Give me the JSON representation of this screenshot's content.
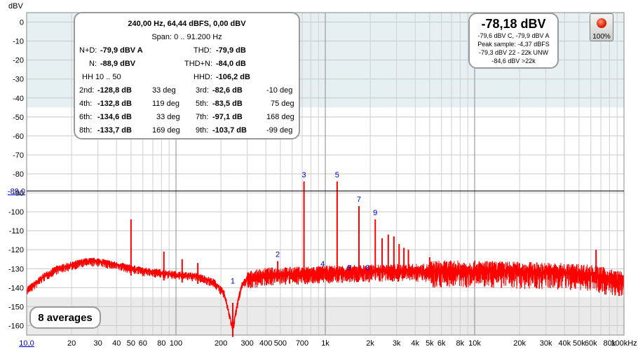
{
  "chart_data": {
    "type": "line",
    "title": "",
    "xlabel": "",
    "ylabel": "dBV",
    "x_unit": "kHz",
    "xscale": "log",
    "xlim": [
      10,
      100000
    ],
    "ylim": [
      -165,
      5
    ],
    "y_ticks": [
      "0",
      "-10",
      "-20",
      "-30",
      "-40",
      "-50",
      "-60",
      "-70",
      "-80",
      "-90",
      "-100",
      "-110",
      "-120",
      "-130",
      "-140",
      "-150",
      "-160"
    ],
    "x_tick_labels": [
      {
        "f": 20,
        "t": "20"
      },
      {
        "f": 30,
        "t": "30"
      },
      {
        "f": 40,
        "t": "40"
      },
      {
        "f": 50,
        "t": "50"
      },
      {
        "f": 60,
        "t": "60"
      },
      {
        "f": 80,
        "t": "80"
      },
      {
        "f": 100,
        "t": "100"
      },
      {
        "f": 200,
        "t": "200"
      },
      {
        "f": 300,
        "t": "300"
      },
      {
        "f": 400,
        "t": "400"
      },
      {
        "f": 500,
        "t": "500"
      },
      {
        "f": 700,
        "t": "700"
      },
      {
        "f": 1000,
        "t": "1k"
      },
      {
        "f": 2000,
        "t": "2k"
      },
      {
        "f": 3000,
        "t": "3k"
      },
      {
        "f": 4000,
        "t": "4k"
      },
      {
        "f": 5000,
        "t": "5k"
      },
      {
        "f": 6000,
        "t": "6k"
      },
      {
        "f": 8000,
        "t": "8k"
      },
      {
        "f": 10000,
        "t": "10k"
      },
      {
        "f": 20000,
        "t": "20k"
      },
      {
        "f": 30000,
        "t": "30k"
      },
      {
        "f": 40000,
        "t": "40k"
      },
      {
        "f": 50000,
        "t": "50k"
      },
      {
        "f": 60000,
        "t": "60k"
      },
      {
        "f": 80000,
        "t": "80k"
      },
      {
        "f": 100000,
        "t": "100kHz"
      }
    ],
    "x_min_label": "10,0",
    "cursor_level_label": "-89,0",
    "cursor_level": -89.0,
    "series": [
      {
        "color": "#ff0000",
        "floor": [
          [
            10,
            -141
          ],
          [
            11,
            -139
          ],
          [
            13,
            -134
          ],
          [
            16,
            -130
          ],
          [
            20,
            -128
          ],
          [
            25,
            -126
          ],
          [
            30,
            -126
          ],
          [
            40,
            -128
          ],
          [
            60,
            -131
          ],
          [
            100,
            -133
          ],
          [
            140,
            -134
          ],
          [
            180,
            -137
          ],
          [
            210,
            -143
          ],
          [
            225,
            -152
          ],
          [
            240,
            -162
          ],
          [
            255,
            -150
          ],
          [
            275,
            -139
          ],
          [
            300,
            -135
          ],
          [
            400,
            -133
          ],
          [
            1000,
            -132
          ],
          [
            3000,
            -131
          ],
          [
            10000,
            -131
          ],
          [
            30000,
            -132
          ],
          [
            60000,
            -133
          ],
          [
            100000,
            -137
          ]
        ],
        "peaks": [
          [
            50,
            -104
          ],
          [
            83,
            -121
          ],
          [
            110,
            -125
          ],
          [
            140,
            -127
          ],
          [
            240,
            -148
          ],
          [
            480,
            -126
          ],
          [
            720,
            -84
          ],
          [
            960,
            -131
          ],
          [
            1200,
            -84
          ],
          [
            1440,
            -133
          ],
          [
            1680,
            -97
          ],
          [
            1920,
            -133
          ],
          [
            2160,
            -104
          ],
          [
            2400,
            -114
          ],
          [
            2640,
            -112
          ],
          [
            2880,
            -113
          ],
          [
            3120,
            -117
          ],
          [
            3360,
            -119
          ],
          [
            3600,
            -120
          ],
          [
            5000,
            -124
          ],
          [
            65000,
            -120
          ]
        ]
      }
    ],
    "harmonic_markers": [
      {
        "label": "1",
        "f": 240,
        "level": -140
      },
      {
        "label": "2",
        "f": 480,
        "level": -126
      },
      {
        "label": "3",
        "f": 720,
        "level": -84
      },
      {
        "label": "4",
        "f": 960,
        "level": -131
      },
      {
        "label": "5",
        "f": 1200,
        "level": -84
      },
      {
        "label": "6",
        "f": 1440,
        "level": -133
      },
      {
        "label": "7",
        "f": 1680,
        "level": -97
      },
      {
        "label": "8",
        "f": 1920,
        "level": -133
      },
      {
        "label": "9",
        "f": 2160,
        "level": -104
      }
    ]
  },
  "stats": {
    "header": "240,00 Hz, 64,44 dBFS, 0,00 dBV",
    "span": "Span: 0 .. 91.200 Hz",
    "nd_label": "N+D:",
    "nd_value": "-79,9 dBV A",
    "thd_label": "THD:",
    "thd_value": "-79,9 dB",
    "n_label": "N:",
    "n_value": "-88,9 dBV",
    "thdn_label": "THD+N:",
    "thdn_value": "-84,0 dB",
    "hh_label": "HH 10 .. 50",
    "hhd_label": "HHD:",
    "hhd_value": "-106,2 dB",
    "harmonics": [
      {
        "label": "2nd:",
        "value": "-128,8 dB",
        "phase": "33 deg"
      },
      {
        "label": "3rd:",
        "value": "-82,6 dB",
        "phase": "-10 deg"
      },
      {
        "label": "4th:",
        "value": "-132,8 dB",
        "phase": "119 deg"
      },
      {
        "label": "5th:",
        "value": "-83,5 dB",
        "phase": "75 deg"
      },
      {
        "label": "6th:",
        "value": "-134,6 dB",
        "phase": "33 deg"
      },
      {
        "label": "7th:",
        "value": "-97,1 dB",
        "phase": "168 deg"
      },
      {
        "label": "8th:",
        "value": "-133,7 dB",
        "phase": "169 deg"
      },
      {
        "label": "9th:",
        "value": "-103,7 dB",
        "phase": "-99 deg"
      }
    ]
  },
  "level": {
    "main": "-78,18 dBV",
    "line1": "-79,6 dBV C, -79,9 dBV A",
    "line2": "Peak sample: -4,37 dBFS",
    "line3": "-79,3 dBV 22 - 22k UNW",
    "line4": "-84,6 dBV >22k"
  },
  "averages": "8 averages",
  "record": {
    "percent": "100%"
  },
  "colors": {
    "trace": "#ff0000",
    "marker": "#0000cc",
    "plot_band": "#e6f0f2",
    "plot_grey": "#eaeaea"
  }
}
